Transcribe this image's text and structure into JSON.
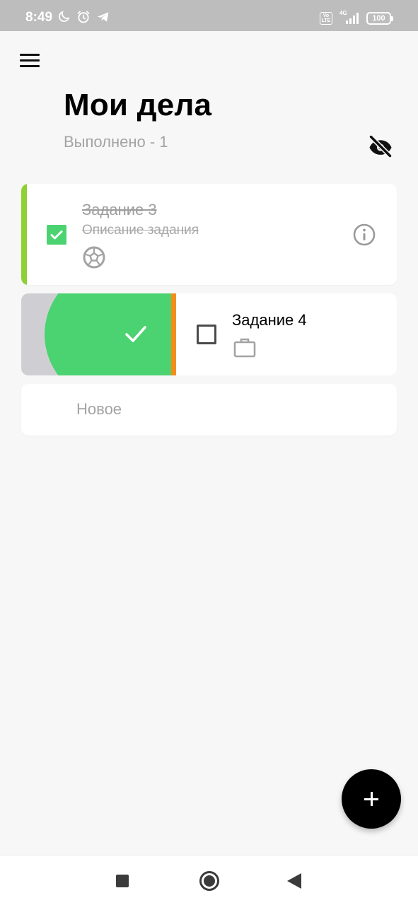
{
  "status_bar": {
    "time": "8:49",
    "icons": [
      "moon-icon",
      "alarm-icon",
      "telegram-icon",
      "volte-icon",
      "signal-icon"
    ],
    "network": "4G",
    "volte": "Vo LTE",
    "battery": "100"
  },
  "header": {
    "menu_icon": "hamburger-icon",
    "title": "Мои дела",
    "completed_counter": "Выполнено - 1",
    "visibility_icon": "eye-off-icon"
  },
  "tasks": [
    {
      "title": "Задание 3",
      "description": "Описание задания",
      "completed": true,
      "accent_color": "#8fd035",
      "category_icon": "soccer-ball-icon",
      "info_icon": "info-icon"
    },
    {
      "title": "Задание 4",
      "completed": false,
      "accent_color": "#f28f1b",
      "category_icon": "briefcase-icon",
      "swipe_action": "complete",
      "swipe_action_color": "#4cd371"
    }
  ],
  "new_task": {
    "placeholder": "Новое"
  },
  "fab": {
    "icon": "plus-icon"
  },
  "nav_bar": {
    "icons": [
      "recents-icon",
      "home-icon",
      "back-icon"
    ]
  },
  "colors": {
    "background": "#f7f7f7",
    "check_green": "#4cd371",
    "status_bar": "#bdbdbd"
  }
}
